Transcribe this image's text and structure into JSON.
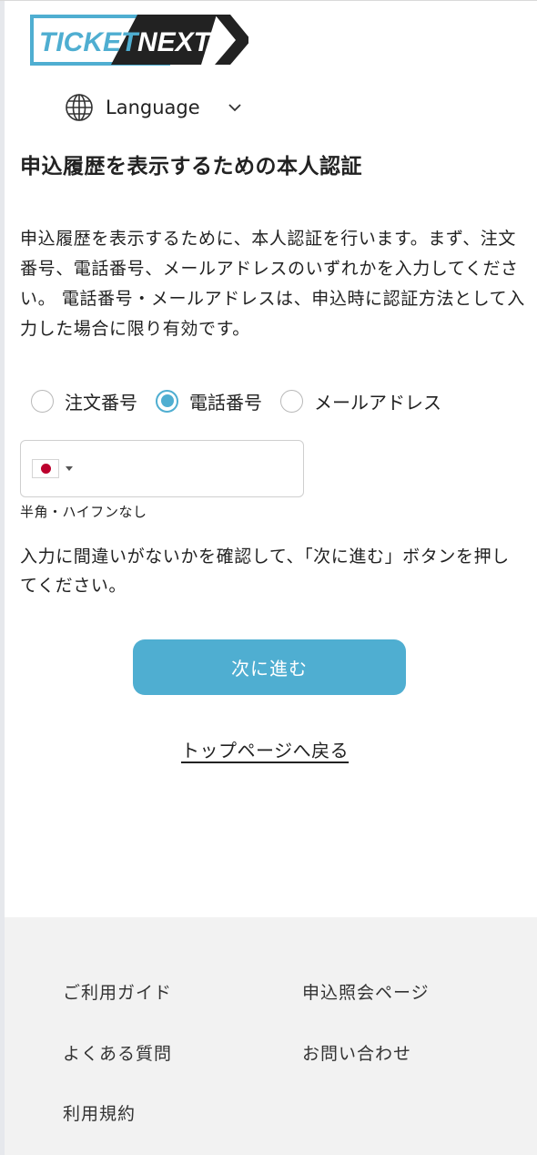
{
  "brand": {
    "logo_text_left": "TICKET",
    "logo_text_right": "NEXT",
    "accent_color": "#4faed1",
    "dark_color": "#222222"
  },
  "language": {
    "label": "Language",
    "icon": "globe-icon"
  },
  "page": {
    "title": "申込履歴を表示するための本人認証",
    "description": "申込履歴を表示するために、本人認証を行います。まず、注文番号、電話番号、メールアドレスのいずれかを入力してください。 電話番号・メールアドレスは、申込時に認証方法として入力した場合に限り有効です。"
  },
  "auth_method": {
    "options": [
      {
        "label": "注文番号",
        "selected": false
      },
      {
        "label": "電話番号",
        "selected": true
      },
      {
        "label": "メールアドレス",
        "selected": false
      }
    ]
  },
  "phone": {
    "country": "JP",
    "value": "",
    "hint": "半角・ハイフンなし"
  },
  "confirm_text": "入力に間違いがないかを確認して、「次に進む」ボタンを押してください。",
  "buttons": {
    "next": "次に進む",
    "top_page": "トップページへ戻る"
  },
  "footer": {
    "links": {
      "guide": "ご利用ガイド",
      "inquiry_page": "申込照会ページ",
      "faq": "よくある質問",
      "contact": "お問い合わせ",
      "terms": "利用規約"
    }
  }
}
